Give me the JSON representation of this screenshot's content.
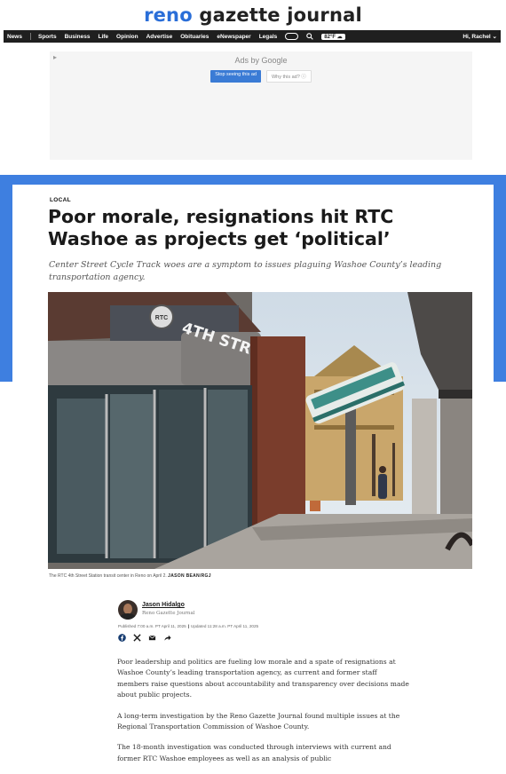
{
  "masthead": {
    "logo_part1": "reno",
    "logo_part2": "gazette journal"
  },
  "nav": {
    "items": [
      "News",
      "Sports",
      "Business",
      "Life",
      "Opinion",
      "Advertise",
      "Obituaries",
      "eNewspaper",
      "Legals"
    ],
    "badge": "82°F ☁",
    "user": "Hi, Rachel ⌄"
  },
  "ad": {
    "info_icon": "▸",
    "ads_by": "Ads by Google",
    "stop_label": "Stop seeing this ad",
    "why_label": "Why this ad? ⓘ"
  },
  "article": {
    "kicker": "LOCAL",
    "headline": "Poor morale, resignations hit RTC Washoe as projects get ‘political’",
    "dek": "Center Street Cycle Track woes are a symptom to issues plaguing Washoe County’s leading transportation agency.",
    "photo_sign_text": "4TH STREET",
    "photo_logo_text": "RTC",
    "caption": "The RTC 4th Street Station transit center in Reno on April 2.",
    "caption_credit": "JASON BEAN/RGJ"
  },
  "byline": {
    "author": "Jason Hidalgo",
    "org": "Reno Gazette Journal",
    "published": "Published 7:00 a.m. PT April 11, 2025",
    "updated": "Updated 11:28 a.m. PT April 11, 2025"
  },
  "share": {
    "icons": [
      "facebook-icon",
      "x-icon",
      "email-icon",
      "share-icon"
    ]
  },
  "body": {
    "paragraphs": [
      "Poor leadership and politics are fueling low morale and a spate of resignations at Washoe County’s leading transportation agency, as current and former staff members raise questions about accountability and transparency over decisions made about public projects.",
      "A long-term investigation by the Reno Gazette Journal found multiple issues at the Regional Transportation Commission of Washoe County.",
      "The 18-month investigation was conducted through interviews with current and former RTC Washoe employees as well as an analysis of public"
    ]
  },
  "colors": {
    "brand_blue": "#2a6ed8",
    "band_blue": "#3e7fe0",
    "nav_bg": "#1f1f1f"
  }
}
